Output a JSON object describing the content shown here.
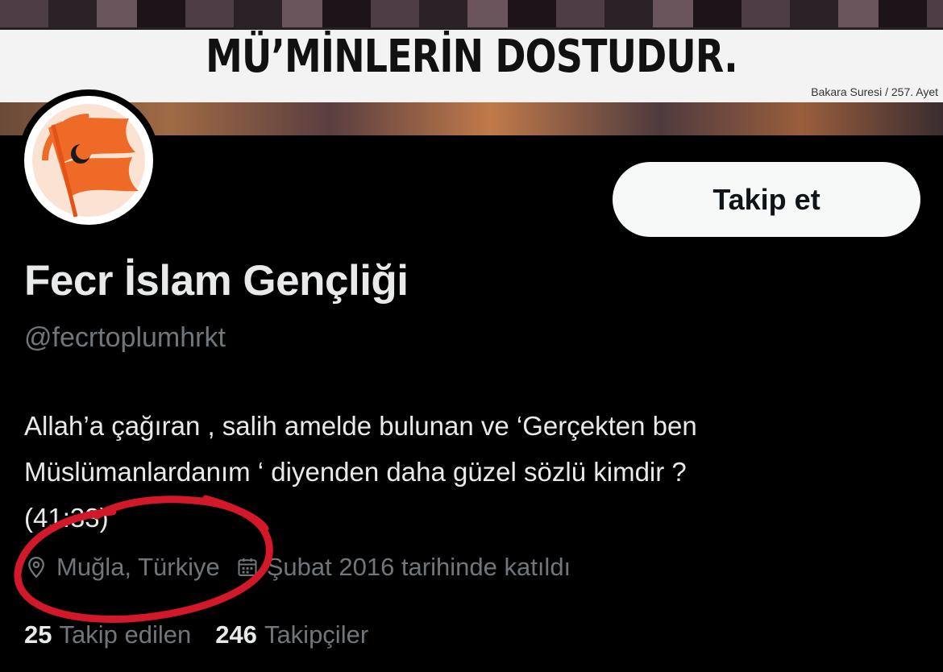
{
  "banner": {
    "headline": "MÜ’MİNLERİN DOSTUDUR.",
    "source": "Bakara Suresi / 257. Ayet"
  },
  "profile": {
    "avatar_icon": "flag-crescent-logo",
    "follow_label": "Takip et",
    "display_name": "Fecr İslam Gençliği",
    "handle": "@fecrtoplumhrkt",
    "bio_lines": [
      "Allah’a çağıran , salih amelde bulunan ve ‘Gerçekten ben",
      "Müslümanlardanım ‘ diyenden daha güzel sözlü kimdir ?",
      "(41:33)"
    ],
    "location": "Muğla, Türkiye",
    "joined": "Şubat 2016 tarihinde katıldı",
    "following_count": "25",
    "following_label": "Takip edilen",
    "followers_count": "246",
    "followers_label": "Takipçiler"
  },
  "colors": {
    "background": "#000000",
    "primary_text": "#e7e9ea",
    "secondary_text": "#71767b",
    "button_bg": "#f7f9f9",
    "logo_orange": "#ef6a26",
    "annotation_red": "#d3182a"
  }
}
